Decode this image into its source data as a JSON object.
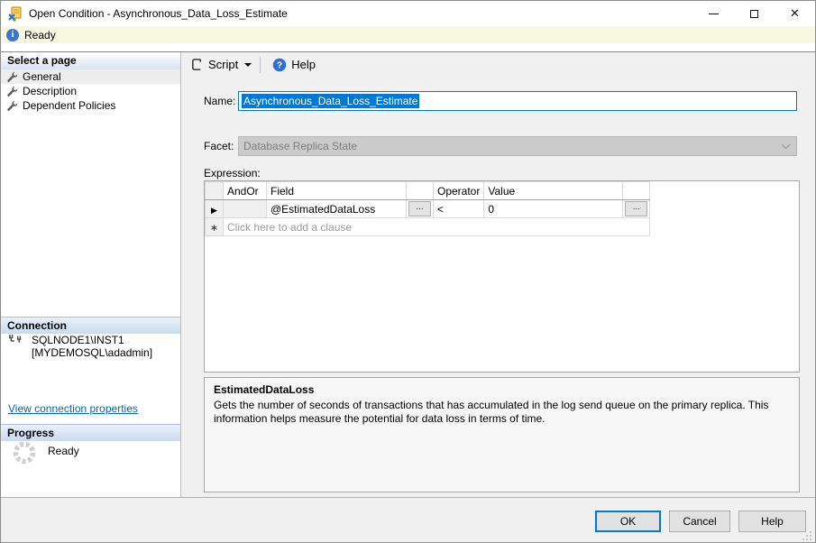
{
  "window": {
    "title": "Open Condition - Asynchronous_Data_Loss_Estimate",
    "controls": {
      "minimize": "minimize",
      "maximize": "maximize",
      "close": "✕"
    }
  },
  "status_bar": {
    "text": "Ready"
  },
  "sidebar": {
    "pages_header": "Select a page",
    "pages": [
      {
        "label": "General",
        "selected": true
      },
      {
        "label": "Description",
        "selected": false
      },
      {
        "label": "Dependent Policies",
        "selected": false
      }
    ],
    "connection_header": "Connection",
    "connection": {
      "line1": "SQLNODE1\\INST1",
      "line2": "[MYDEMOSQL\\adadmin]"
    },
    "connection_link": "View connection properties",
    "progress_header": "Progress",
    "progress_status": "Ready"
  },
  "toolbar": {
    "script_label": "Script",
    "help_label": "Help"
  },
  "form": {
    "name_label": "Name:",
    "name_value": "Asynchronous_Data_Loss_Estimate",
    "facet_label": "Facet:",
    "facet_value": "Database Replica State",
    "expression_label": "Expression:"
  },
  "expression_grid": {
    "columns": [
      "AndOr",
      "Field",
      "Operator",
      "Value"
    ],
    "ellipsis_label": "...",
    "rows": [
      {
        "and_or": "",
        "field": "@EstimatedDataLoss",
        "operator": "<",
        "value": "0"
      }
    ],
    "new_row_hint": "Click here to add a clause"
  },
  "description_panel": {
    "title": "EstimatedDataLoss",
    "body": "Gets the number of seconds of transactions that has accumulated in the log send queue on the primary replica. This information helps measure the potential for data loss in terms of time."
  },
  "footer": {
    "ok": "OK",
    "cancel": "Cancel",
    "help": "Help"
  },
  "colors": {
    "selection": "#0078d7",
    "link": "#0563c1",
    "ready_bar": "#f8f8e1"
  }
}
